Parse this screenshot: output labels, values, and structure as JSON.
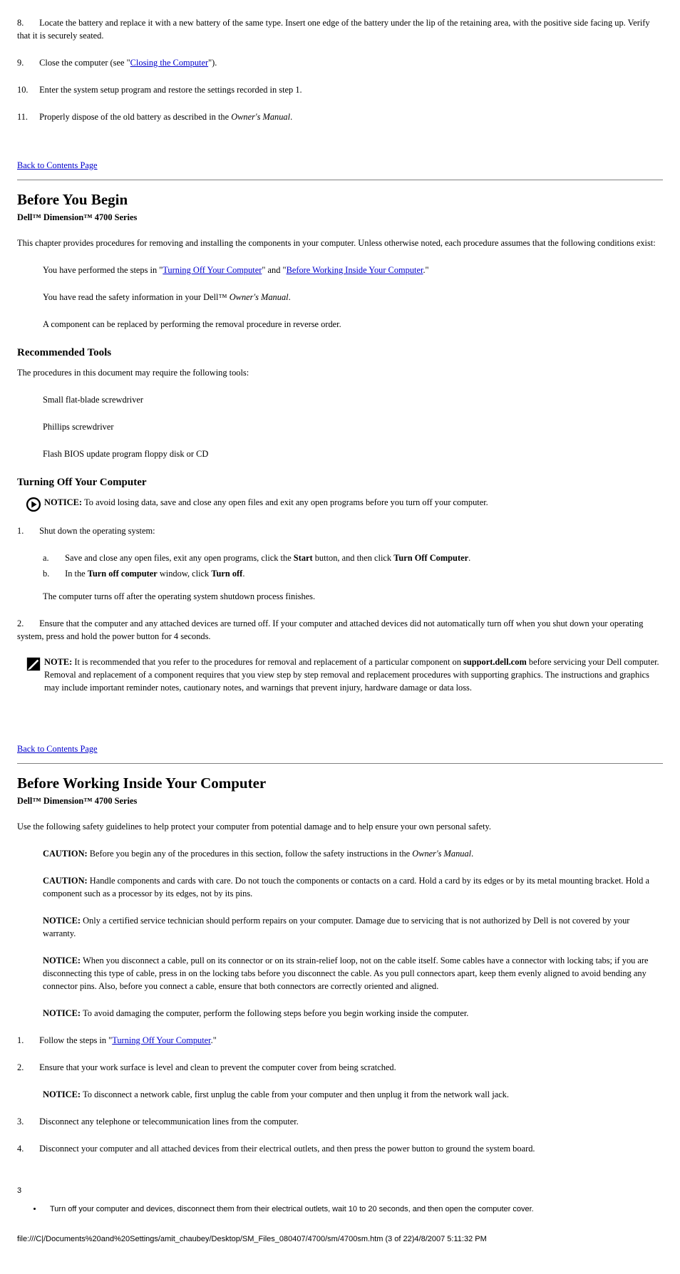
{
  "step8": {
    "num": "8.",
    "text": "Locate the battery and replace it with a new battery of the same type. Insert one edge of the battery under the lip of the retaining area, with the positive side facing up. Verify that it is securely seated."
  },
  "step9": {
    "num": "9.",
    "text_a": "Close the computer (see \"",
    "link": "Closing the Computer",
    "text_b": "\")."
  },
  "step10": {
    "num": "10.",
    "text": "Enter the system setup program and restore the settings recorded in step 1."
  },
  "step11": {
    "num": "11.",
    "text": "Properly dispose of the old battery as described in the ",
    "em": "Owner's Manual",
    "after": "."
  },
  "backlink1": "Back to Contents Page",
  "sec1": {
    "title": "Before You Begin",
    "product": "Dell™ Dimension™ 4700 Series",
    "p1": "This chapter provides procedures for removing and installing the components in your computer. Unless otherwise noted, each procedure assumes that the following conditions exist:",
    "b1_a": "You have performed the steps in \"",
    "b1_link": "Turning Off Your Computer",
    "b1_b": "\" and \"",
    "b1_link2": "Before Working Inside Your Computer",
    "b1_c": ".\"",
    "b2_a": "You have read the safety information in your Dell™ ",
    "b2_em": "Owner's Manual",
    "b2_b": ".",
    "b3": "A component can be replaced by performing the removal procedure in reverse order."
  },
  "tools": {
    "heading": "Recommended Tools",
    "p": "The procedures in this document may require the following tools:",
    "t1": "Small flat-blade screwdriver",
    "t2": "Phillips screwdriver",
    "t3": "Flash BIOS update program floppy disk or CD"
  },
  "turnoff": {
    "heading": "Turning Off Your Computer"
  },
  "notice": {
    "label": "NOTICE: ",
    "text": "To avoid losing data, save and close any open files and exit any open programs before you turn off your computer."
  },
  "shutdown": {
    "num1": "1.",
    "t1": "Shut down the operating system:",
    "a": {
      "num": "a.",
      "pre": "Save and close any open files, exit any open programs, click the ",
      "b": "Start",
      "mid": " button, and then click ",
      "b2": "Turn Off Computer",
      "after": "."
    },
    "b": {
      "num": "b.",
      "pre": "In the ",
      "b": "Turn off computer",
      "mid": " window, click ",
      "b2": "Turn off",
      "after": "."
    },
    "tail": "The computer turns off after the operating system shutdown process finishes.",
    "num2": "2.",
    "t2": "Ensure that the computer and any attached devices are turned off. If your computer and attached devices did not automatically turn off when you shut down your operating system, press and hold the power button for 4 seconds."
  },
  "note": {
    "label": "NOTE: ",
    "text_a": "It is recommended that you refer to the procedures for removal and replacement of a particular component on ",
    "bold": "support.dell.com",
    "text_b": " before servicing your Dell computer. Removal and replacement of a component requires that you view step by step removal and replacement procedures with supporting graphics. The instructions and graphics may include important reminder notes, cautionary notes, and warnings that prevent injury, hardware damage or data loss."
  },
  "backlink2": "Back to Contents Page",
  "sec2": {
    "title": "Before Working Inside Your Computer",
    "product": "Dell™ Dimension™ 4700 Series",
    "p": "Use the following safety guidelines to help protect your computer from potential damage and to help ensure your own personal safety."
  },
  "caution1": {
    "label": "CAUTION: ",
    "text_a": "Before you begin any of the procedures in this section, follow the safety instructions in the ",
    "em": "Owner's Manual",
    "text_b": "."
  },
  "caution2": {
    "label": "CAUTION: ",
    "text": "Handle components and cards with care. Do not touch the components or contacts on a card. Hold a card by its edges or by its metal mounting bracket. Hold a component such as a processor by its edges, not by its pins."
  },
  "notice2": {
    "label": "NOTICE: ",
    "text": "Only a certified service technician should perform repairs on your computer. Damage due to servicing that is not authorized by Dell is not covered by your warranty."
  },
  "notice3": {
    "label": "NOTICE: ",
    "text": "When you disconnect a cable, pull on its connector or on its strain-relief loop, not on the cable itself. Some cables have a connector with locking tabs; if you are disconnecting this type of cable, press in on the locking tabs before you disconnect the cable. As you pull connectors apart, keep them evenly aligned to avoid bending any connector pins. Also, before you connect a cable, ensure that both connectors are correctly oriented and aligned."
  },
  "notice4": {
    "label": "NOTICE: ",
    "text": "To avoid damaging the computer, perform the following steps before you begin working inside the computer."
  },
  "bw": {
    "s1": {
      "num": "1.",
      "t_a": "Follow the steps in \"",
      "link": "Turning Off Your Computer",
      "t_b": ".\""
    },
    "s2": {
      "num": "2.",
      "t": "Ensure that your work surface is level and clean to prevent the computer cover from being scratched."
    }
  },
  "notice5": {
    "label": "NOTICE: ",
    "text": "To disconnect a network cable, first unplug the cable from your computer and then unplug it from the network wall jack."
  },
  "bw2": {
    "s3": {
      "num": "3.",
      "t": "Disconnect any telephone or telecommunication lines from the computer."
    },
    "s4": {
      "num": "4.",
      "t": "Disconnect your computer and all attached devices from their electrical outlets, and then press the power button to ground the system board."
    }
  },
  "footer": {
    "pagenum": "3",
    "bullet": "Turn off your computer and devices, disconnect them from their electrical outlets, wait 10 to 20 seconds, and then open the computer cover.",
    "bottom": "file:///C|/Documents%20and%20Settings/amit_chaubey/Desktop/SM_Files_080407/4700/sm/4700sm.htm (3 of 22)4/8/2007 5:11:32 PM"
  }
}
